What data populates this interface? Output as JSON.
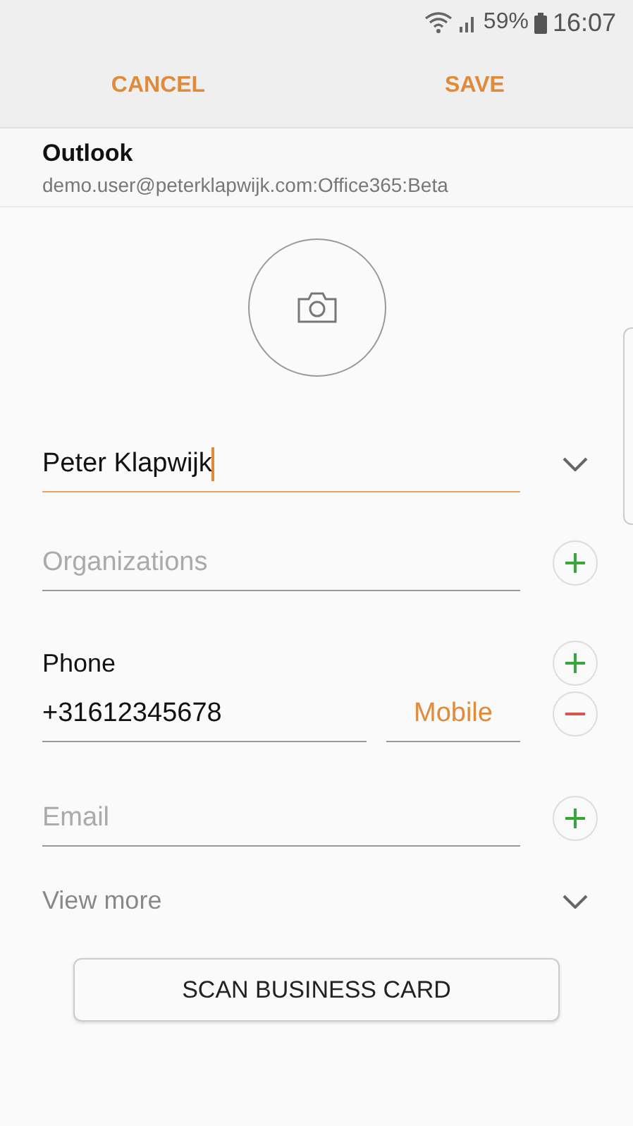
{
  "status_bar": {
    "battery": "59%",
    "time": "16:07"
  },
  "actions": [
    {
      "label": "CANCEL"
    },
    {
      "label": "SAVE"
    }
  ],
  "account": {
    "title": "Outlook",
    "subtitle": "demo.user@peterklapwijk.com:Office365:Beta"
  },
  "name_field": {
    "value": "Peter Klapwijk",
    "focused": true
  },
  "organizations": {
    "placeholder": "Organizations"
  },
  "phone": {
    "label": "Phone",
    "number": "+31612345678",
    "type": "Mobile"
  },
  "email": {
    "placeholder": "Email"
  },
  "view_more": "View more",
  "scan_button": "SCAN BUSINESS CARD"
}
